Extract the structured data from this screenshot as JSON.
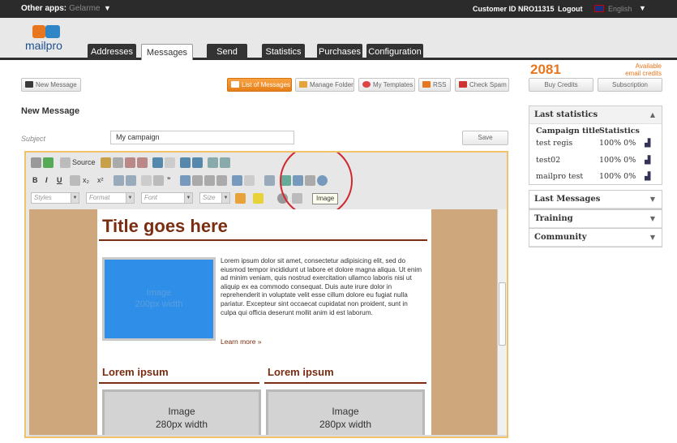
{
  "topbar": {
    "other_apps_label": "Other apps:",
    "other_apps_value": "Gelarme",
    "customer_id": "Customer ID NRO11315",
    "logout": "Logout",
    "language": "English"
  },
  "logo": {
    "text": "mailpro"
  },
  "tabs": [
    {
      "label": "Addresses",
      "active": false
    },
    {
      "label": "Messages",
      "active": true
    },
    {
      "label": "Send",
      "active": false
    },
    {
      "label": "Statistics",
      "active": false
    },
    {
      "label": "Purchases",
      "active": false
    },
    {
      "label": "Configuration",
      "active": false
    }
  ],
  "toolbar": {
    "new_message": "New Message",
    "list_of_messages": "List of Messages",
    "manage_folder": "Manage Folder",
    "my_templates": "My Templates",
    "rss": "RSS",
    "check_spam": "Check Spam",
    "buy_credits": "Buy Credits",
    "subscription": "Subscription"
  },
  "credits": {
    "value": "2081",
    "label": "Available email credits"
  },
  "form": {
    "heading": "New Message",
    "subject_label": "Subject",
    "subject_value": "My campaign",
    "save": "Save"
  },
  "editor": {
    "source_label": "Source",
    "styles": "Styles",
    "format": "Format",
    "font": "Font",
    "size": "Size",
    "tooltip": "Image",
    "page": {
      "title": "Title goes here",
      "image1_line1": "Image",
      "image1_line2": "200px width",
      "lorem": "Lorem ipsum dolor sit amet, consectetur adipisicing elit, sed do eiusmod tempor incididunt ut labore et dolore magna aliqua. Ut enim ad minim veniam, quis nostrud exercitation ullamco laboris nisi ut aliquip ex ea commodo consequat. Duis aute irure dolor in reprehenderit in voluptate velit esse cillum dolore eu fugiat nulla pariatur. Excepteur sint occaecat cupidatat non proident, sunt in culpa qui officia deserunt mollit anim id est laborum.",
      "learn_more": "Learn more »",
      "col1_heading": "Lorem ipsum",
      "col2_heading": "Lorem ipsum",
      "image2_line1": "Image",
      "image2_line2": "280px width",
      "image3_line1": "Image",
      "image3_line2": "280px width"
    }
  },
  "sidebar": {
    "last_statistics": "Last statistics",
    "col_title": "Campaign title",
    "col_stats": "Statistics",
    "rows": [
      {
        "title": "test regis",
        "stats": "100% 0%"
      },
      {
        "title": "test02",
        "stats": "100% 0%"
      },
      {
        "title": "mailpro test",
        "stats": "100% 0%"
      }
    ],
    "last_messages": "Last Messages",
    "training": "Training",
    "community": "Community"
  },
  "colors": {
    "accent": "#e8761f",
    "brand_blue": "#1d4f8f",
    "title_brown": "#7b2d12",
    "highlight_circle": "#d0282e"
  }
}
